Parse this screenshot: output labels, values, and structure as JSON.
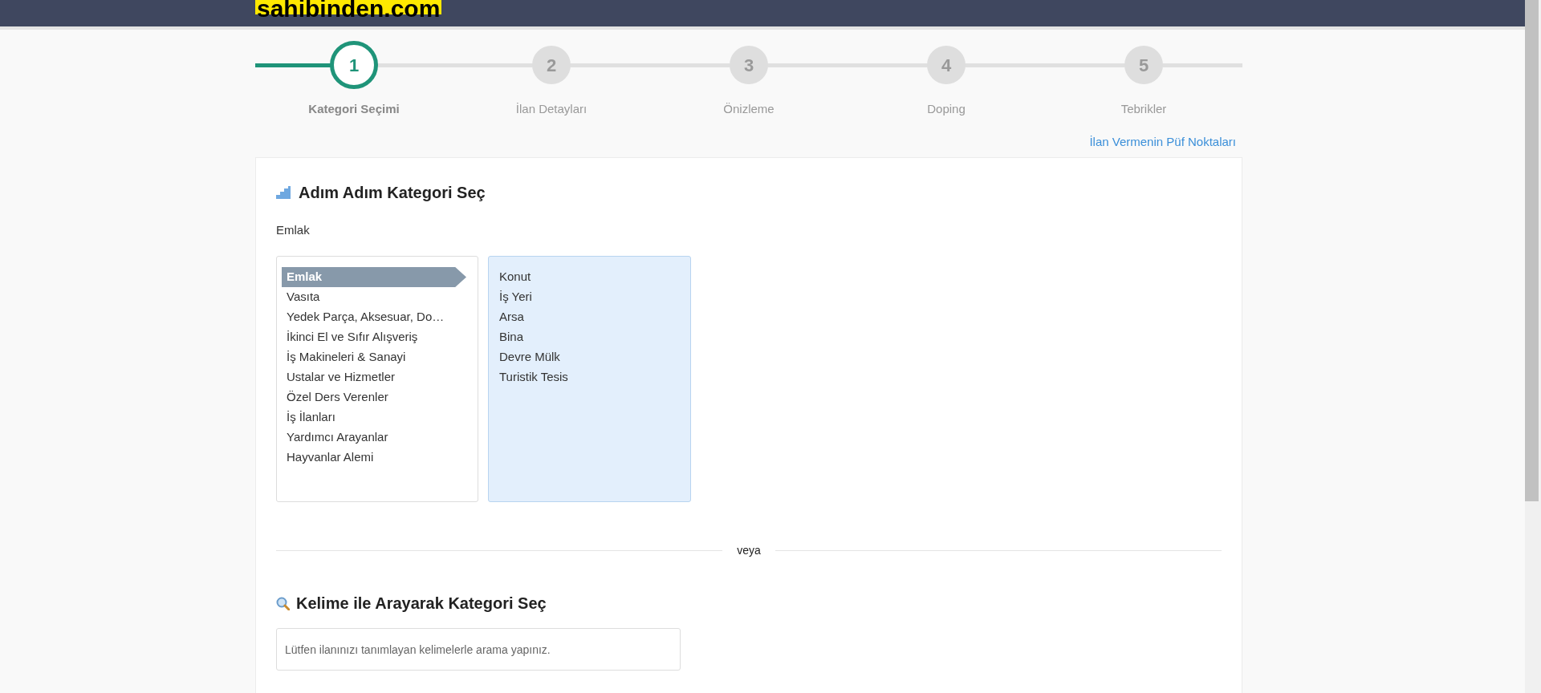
{
  "header": {
    "logo": "sahibinden.com"
  },
  "steps": [
    {
      "number": "1",
      "label": "Kategori Seçimi",
      "selected": true
    },
    {
      "number": "2",
      "label": "İlan Detayları",
      "selected": false
    },
    {
      "number": "3",
      "label": "Önizleme",
      "selected": false
    },
    {
      "number": "4",
      "label": "Doping",
      "selected": false
    },
    {
      "number": "5",
      "label": "Tebrikler",
      "selected": false
    }
  ],
  "tips_link": "İlan Vermenin Püf Noktaları",
  "step_by_step": {
    "title": "Adım Adım Kategori Seç",
    "breadcrumb": "Emlak",
    "categories": [
      {
        "label": "Emlak",
        "selected": true
      },
      {
        "label": "Vasıta",
        "selected": false
      },
      {
        "label": "Yedek Parça, Aksesuar, Do…",
        "selected": false
      },
      {
        "label": "İkinci El ve Sıfır Alışveriş",
        "selected": false
      },
      {
        "label": "İş Makineleri & Sanayi",
        "selected": false
      },
      {
        "label": "Ustalar ve Hizmetler",
        "selected": false
      },
      {
        "label": "Özel Ders Verenler",
        "selected": false
      },
      {
        "label": "İş İlanları",
        "selected": false
      },
      {
        "label": "Yardımcı Arayanlar",
        "selected": false
      },
      {
        "label": "Hayvanlar Alemi",
        "selected": false
      }
    ],
    "subcategories": [
      "Konut",
      "İş Yeri",
      "Arsa",
      "Bina",
      "Devre Mülk",
      "Turistik Tesis"
    ]
  },
  "divider": "veya",
  "keyword_search": {
    "title": "Kelime ile Arayarak Kategori Seç",
    "placeholder": "Lütfen ilanınızı tanımlayan kelimelerle arama yapınız."
  }
}
